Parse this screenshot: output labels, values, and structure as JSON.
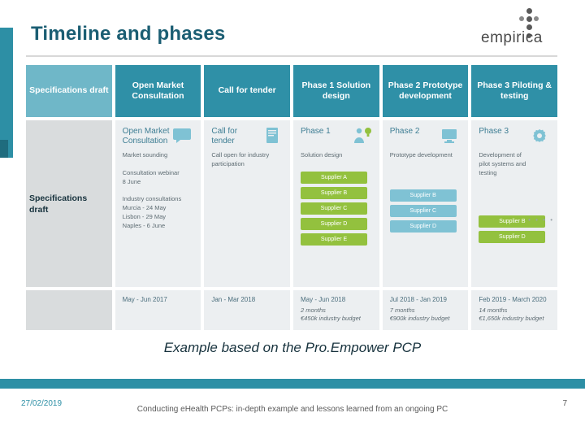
{
  "logo": {
    "text": "empirica",
    "dots_icon": "three-dots-icon"
  },
  "slide": {
    "title": "Timeline and phases",
    "caption": "Example based on the Pro.Empower PCP",
    "overlay_label": "Specifications\ndraft"
  },
  "phases": [
    {
      "label": "Specifications\ndraft",
      "style": "pale"
    },
    {
      "label": "Open Market\nConsultation",
      "style": "solid"
    },
    {
      "label": "Call for tender",
      "style": "solid"
    },
    {
      "label": "Phase 1\nSolution design",
      "style": "solid"
    },
    {
      "label": "Phase 2\nPrototype\ndevelopment",
      "style": "solid"
    },
    {
      "label": "Phase 3\nPiloting &\ntesting",
      "style": "solid"
    }
  ],
  "columns": [
    {
      "head": "",
      "icon": "",
      "sub": "",
      "chips": [],
      "footer_date": "",
      "footer_note": "",
      "grey": true
    },
    {
      "head": "Open Market\nConsultation",
      "icon": "speech-bubble-icon",
      "sub": "Market sounding\n\nConsultation webinar\n8 June\n\nIndustry consultations\nMurcia - 24 May\nLisbon - 29 May\nNaples - 6 June",
      "chips": [],
      "footer_date": "May - Jun 2017",
      "footer_note": ""
    },
    {
      "head": "Call for tender",
      "icon": "document-icon",
      "sub": "Call open for industry\nparticipation",
      "chips": [],
      "footer_date": "Jan - Mar 2018",
      "footer_note": ""
    },
    {
      "head": "Phase 1",
      "icon": "person-idea-icon",
      "sub": "Solution design",
      "chips": [
        "Supplier A",
        "Supplier B",
        "Supplier C",
        "Supplier D",
        "Supplier E"
      ],
      "footer_date": "May - Jun 2018",
      "footer_note": "2 months\n€450k industry budget"
    },
    {
      "head": "Phase 2",
      "icon": "computer-icon",
      "sub": "Prototype development",
      "chips": [
        "Supplier B",
        "Supplier C",
        "Supplier D"
      ],
      "footer_date": "Jul 2018 - Jan 2019",
      "footer_note": "7 months\n€900k industry budget"
    },
    {
      "head": "Phase 3",
      "icon": "gear-icon",
      "sub": "Development of\npilot systems and\ntesting",
      "chips": [
        "Supplier B",
        "Supplier D"
      ],
      "footer_date": "Feb 2019 - March 2020",
      "footer_note": "14 months\n€1,650k industry budget"
    }
  ],
  "footer": {
    "date": "27/02/2019",
    "center": "Conducting eHealth PCPs: in-depth example and lessons learned from an ongoing PC",
    "page": "7"
  }
}
